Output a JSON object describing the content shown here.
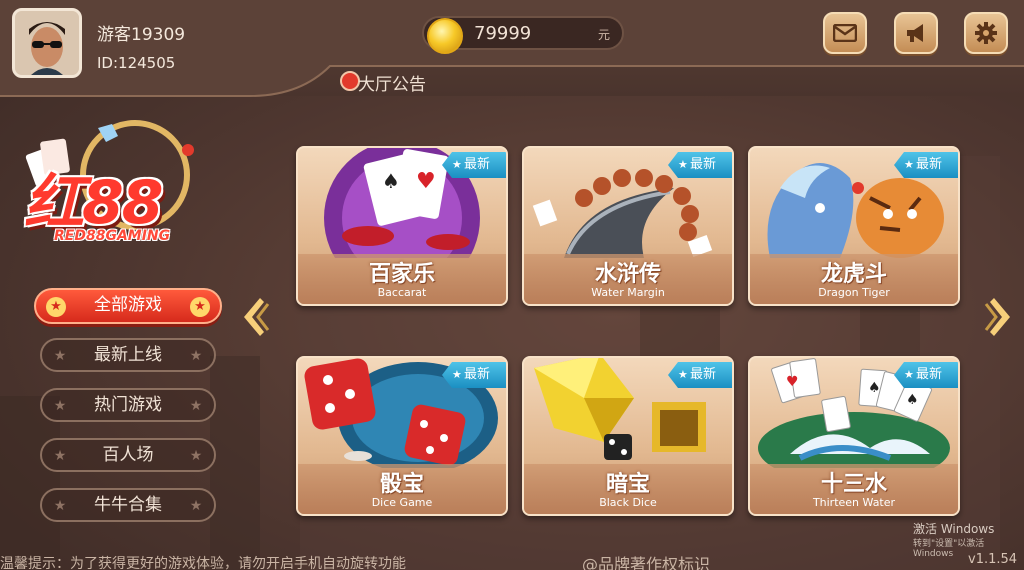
{
  "header": {
    "username": "游客19309",
    "user_id": "ID:124505",
    "coins": "79999",
    "coin_unit": "元",
    "announcement": "大厅公告"
  },
  "logo": {
    "main": "红88",
    "sub": "RED88GAMING"
  },
  "categories": [
    {
      "label": "全部游戏",
      "active": true
    },
    {
      "label": "最新上线",
      "active": false
    },
    {
      "label": "热门游戏",
      "active": false
    },
    {
      "label": "百人场",
      "active": false
    },
    {
      "label": "牛牛合集",
      "active": false
    }
  ],
  "games": [
    {
      "cn": "百家乐",
      "en": "Baccarat",
      "badge": "最新"
    },
    {
      "cn": "水浒传",
      "en": "Water Margin",
      "badge": "最新"
    },
    {
      "cn": "龙虎斗",
      "en": "Dragon Tiger",
      "badge": "最新"
    },
    {
      "cn": "骰宝",
      "en": "Dice Game",
      "badge": "最新"
    },
    {
      "cn": "暗宝",
      "en": "Black Dice",
      "badge": "最新"
    },
    {
      "cn": "十三水",
      "en": "Thirteen Water",
      "badge": "最新"
    }
  ],
  "footer": {
    "tip": "温馨提示：为了获得更好的游戏体验，请勿开启手机自动旋转功能",
    "copyright": "@品牌著作权标识",
    "version": "v1.1.54",
    "windows_line1": "激活 Windows",
    "windows_line2": "转到\"设置\"以激活 Windows"
  },
  "icons": {
    "mail": "mail-icon",
    "announce": "megaphone-icon",
    "settings": "gear-icon",
    "prev": "chevron-left-icon",
    "next": "chevron-right-icon"
  },
  "colors": {
    "accent_red": "#d62a1c",
    "badge_blue": "#1b8fc2",
    "gold": "#f7cf7a"
  }
}
